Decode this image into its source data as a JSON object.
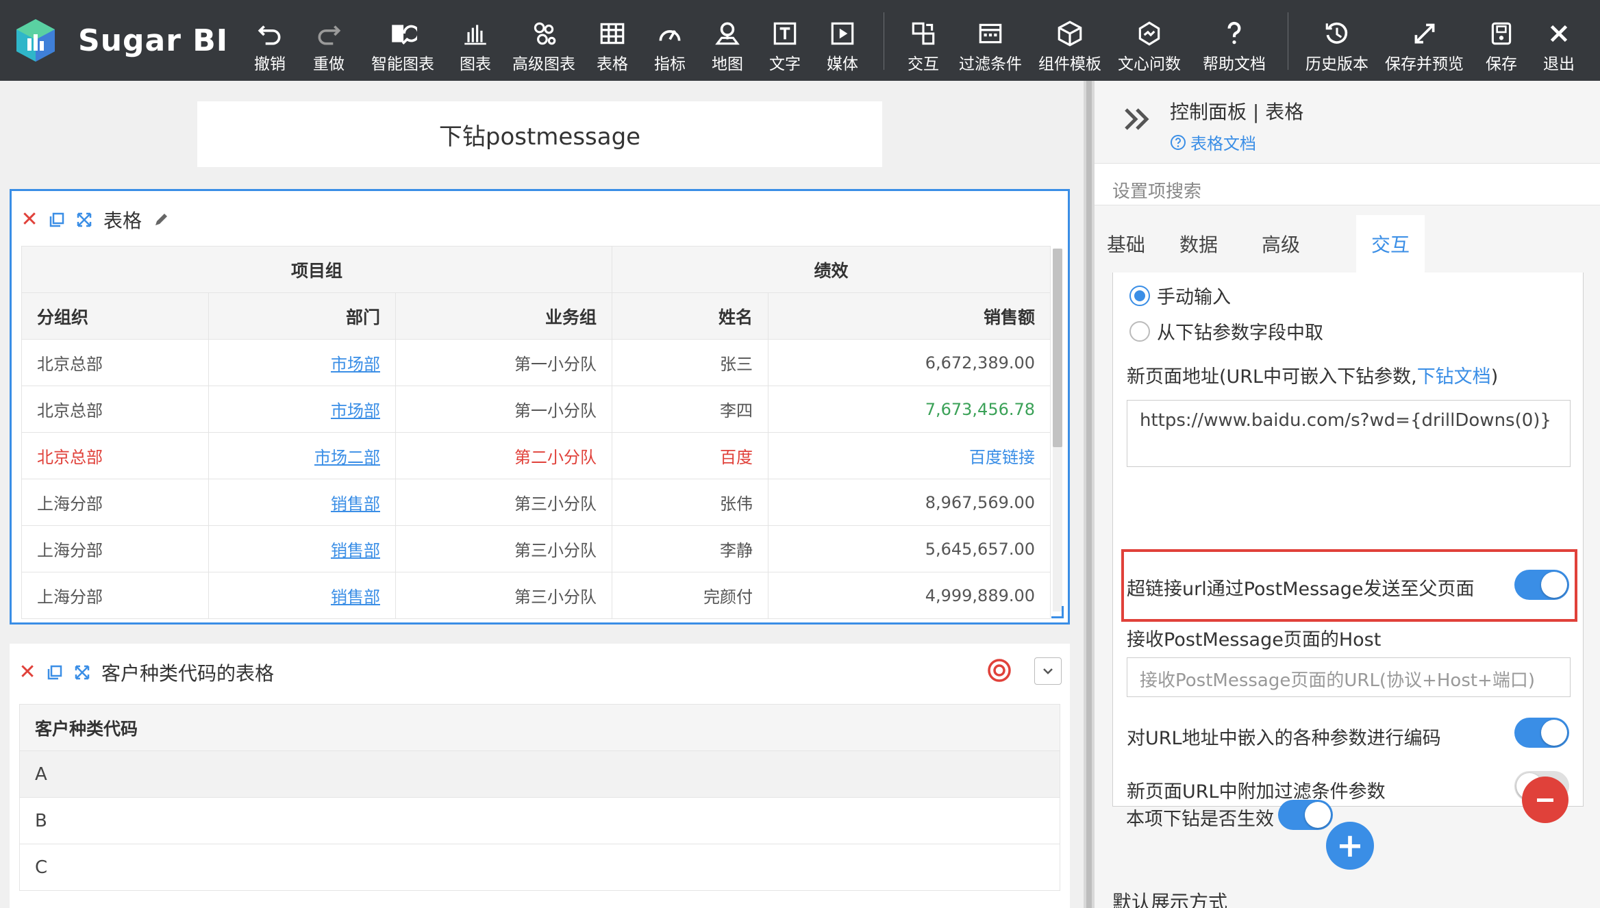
{
  "app": {
    "brand": "Sugar BI",
    "accent": "#3a8ee6",
    "toolbar_bg": "#36393d",
    "danger": "#e0413a"
  },
  "toolbar": {
    "undo": "撤销",
    "redo": "重做",
    "smart_chart": "智能图表",
    "chart": "图表",
    "advanced_chart": "高级图表",
    "table": "表格",
    "metric": "指标",
    "map": "地图",
    "text": "文字",
    "media": "媒体",
    "interaction": "交互",
    "filter": "过滤条件",
    "component_template": "组件模板",
    "wenxin_ask": "文心问数",
    "help_doc": "帮助文档",
    "history": "历史版本",
    "save_preview": "保存并预览",
    "save": "保存",
    "exit": "退出"
  },
  "canvas": {
    "page_title": "下钻postmessage",
    "widget1": {
      "title": "表格",
      "group_headers": [
        "项目组",
        "绩效"
      ],
      "columns": [
        "分组织",
        "部门",
        "业务组",
        "姓名",
        "销售额"
      ],
      "rows": [
        {
          "org": "北京总部",
          "dept": "市场部",
          "team": "第一小分队",
          "name": "张三",
          "sales": "6,672,389.00"
        },
        {
          "org": "北京总部",
          "dept": "市场部",
          "team": "第一小分队",
          "name": "李四",
          "sales": "7,673,456.78"
        },
        {
          "org": "北京总部",
          "dept": "市场二部",
          "team": "第二小分队",
          "name": "百度",
          "sales": "百度链接"
        },
        {
          "org": "上海分部",
          "dept": "销售部",
          "team": "第三小分队",
          "name": "张伟",
          "sales": "8,967,569.00"
        },
        {
          "org": "上海分部",
          "dept": "销售部",
          "team": "第三小分队",
          "name": "李静",
          "sales": "5,645,657.00"
        },
        {
          "org": "上海分部",
          "dept": "销售部",
          "team": "第三小分队",
          "name": "完颜付",
          "sales": "4,999,889.00"
        }
      ]
    },
    "widget2": {
      "title": "客户种类代码的表格",
      "column": "客户种类代码",
      "rows": [
        "A",
        "B",
        "C"
      ]
    }
  },
  "panel": {
    "title": "控制面板 | 表格",
    "doc_link": "表格文档",
    "search_placeholder": "设置项搜索",
    "tabs": [
      "基础",
      "数据",
      "高级",
      "交互"
    ],
    "active_tab": "交互",
    "radio_manual": "手动输入",
    "radio_field": "从下钻参数字段中取",
    "url_label_prefix": "新页面地址(URL中可嵌入下钻参数,",
    "url_label_link": "下钻文档",
    "url_label_suffix": ")",
    "url_value": "https://www.baidu.com/s?wd={drillDowns(0)}",
    "postmessage_label": "超链接url通过PostMessage发送至父页面",
    "postmessage_on": true,
    "host_label": "接收PostMessage页面的Host",
    "host_placeholder": "接收PostMessage页面的URL(协议+Host+端口)",
    "encode_label": "对URL地址中嵌入的各种参数进行编码",
    "encode_on": true,
    "filter_param_label": "新页面URL中附加过滤条件参数",
    "filter_param_on": false,
    "enabled_label": "本项下钻是否生效",
    "enabled_on": true,
    "default_display_label": "默认展示方式"
  }
}
